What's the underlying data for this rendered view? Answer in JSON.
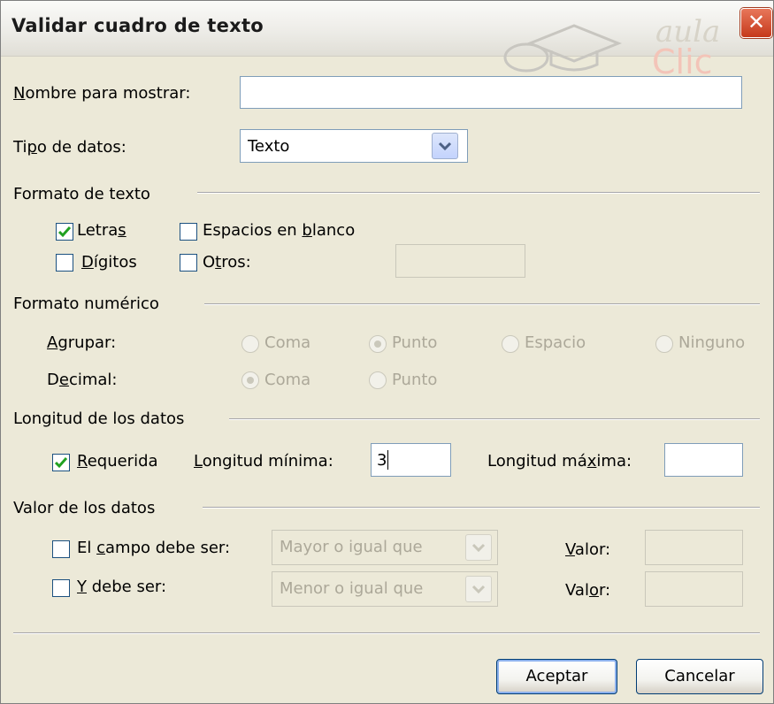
{
  "window": {
    "title": "Validar cuadro de texto",
    "watermark_text": "aula Clic"
  },
  "fields": {
    "display_name_label": "Nombre para mostrar:",
    "display_name_value": "",
    "data_type_label": "Tipo de datos:",
    "data_type_value": "Texto"
  },
  "text_format": {
    "heading": "Formato de texto",
    "letters_label": "Letras",
    "letters_checked": true,
    "spaces_label": "Espacios en blanco",
    "spaces_checked": false,
    "digits_label": "Dígitos",
    "digits_checked": false,
    "others_label": "Otros:",
    "others_checked": false,
    "others_value": ""
  },
  "numeric_format": {
    "heading": "Formato numérico",
    "group_label": "Agrupar:",
    "group_options": [
      "Coma",
      "Punto",
      "Espacio",
      "Ninguno"
    ],
    "group_selected": "Punto",
    "decimal_label": "Decimal:",
    "decimal_options": [
      "Coma",
      "Punto"
    ],
    "decimal_selected": "Coma"
  },
  "data_length": {
    "heading": "Longitud de los datos",
    "required_label": "Requerida",
    "required_checked": true,
    "min_label": "Longitud mínima:",
    "min_value": "3",
    "max_label": "Longitud máxima:",
    "max_value": ""
  },
  "data_value": {
    "heading": "Valor de los datos",
    "field_must_label": "El campo debe ser:",
    "field_must_checked": false,
    "field_must_operator": "Mayor o igual que",
    "value1_label": "Valor:",
    "value1": "",
    "and_must_label": "Y debe ser:",
    "and_must_checked": false,
    "and_must_operator": "Menor o igual que",
    "value2_label": "Valor:",
    "value2": ""
  },
  "buttons": {
    "ok": "Aceptar",
    "cancel": "Cancelar"
  },
  "colors": {
    "dialog_bg": "#ece9d8",
    "check_mark": "#21a121",
    "close_red": "#c5391b"
  }
}
